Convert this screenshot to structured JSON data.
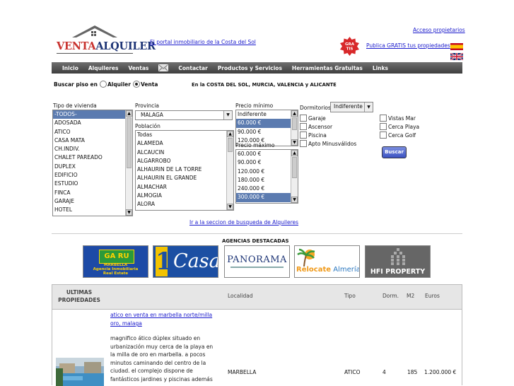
{
  "header": {
    "logo_text_1": "VENTA",
    "logo_text_2": "ALQUILER",
    "tagline": "El portal inmobiliario de la Costa del Sol",
    "access_link": "Acceso propietarios",
    "publish_link": "Publica GRATIS tus propiedades",
    "gratis_badge": "GRATIS"
  },
  "nav": {
    "items": [
      "Inicio",
      "Alquileres",
      "Ventas",
      "Contactar",
      "Productos y Servicios",
      "Herramientas Gratuitas",
      "Links"
    ]
  },
  "search": {
    "label": "Buscar piso en",
    "option_rent": "Alquiler",
    "option_sale": "Venta",
    "selected": "Venta",
    "region_text": "En la COSTA DEL SOL, MURCIA, VALENCIA y ALICANTE",
    "tipo_label": "Tipo de vivienda",
    "tipo_options": [
      "-TODOS-",
      "ADOSADA",
      "ATICO",
      "CASA MATA",
      "CH.INDIV.",
      "CHALET PAREADO",
      "DUPLEX",
      "EDIFICIO",
      "ESTUDIO",
      "FINCA",
      "GARAJE",
      "HOTEL"
    ],
    "provincia_label": "Provincia",
    "provincia_value": "MALAGA",
    "poblacion_label": "Población",
    "poblacion_options": [
      "Todas",
      "ALAMEDA",
      "ALCAUCIN",
      "ALGARROBO",
      "ALHAURIN DE LA TORRE",
      "ALHAURIN EL GRANDE",
      "ALMACHAR",
      "ALMOGIA",
      "ALORA"
    ],
    "precio_min_label": "Precio mínimo",
    "precio_min_options": [
      "Indiferente",
      "60.000 €",
      "90.000 €",
      "120.000 €"
    ],
    "precio_max_label": "Precio máximo",
    "precio_max_options": [
      "60.000 €",
      "90.000 €",
      "120.000 €",
      "180.000 €",
      "240.000 €",
      "300.000 €"
    ],
    "dormitorios_label": "Dormitorios",
    "dormitorios_value": "Indiferente",
    "checks_left": [
      "Garaje",
      "Ascensor",
      "Piscina",
      "Apto Minusválidos"
    ],
    "checks_right": [
      "Vistas Mar",
      "Cerca Playa",
      "Cerca Golf"
    ],
    "button": "Buscar",
    "alquileres_link": "Ir a la seccion de busqueda de Alquileres"
  },
  "agencies": {
    "title": "AGENCIAS DESTACADAS",
    "garu": {
      "top": "GA RU",
      "sub1": "MARBELLA",
      "sub2": "Agencia Inmobiliaria",
      "sub3": "Real Estate"
    },
    "unocasa": {
      "num": "1",
      "word": "Casa"
    },
    "panorama": {
      "name": "PANORAMA"
    },
    "relocate": {
      "word1": "Relocate",
      "word2": "Almería"
    },
    "hfi": {
      "name": "HFI PROPERTY"
    }
  },
  "table": {
    "headers": {
      "title_1": "ULTIMAS",
      "title_2": "PROPIEDADES",
      "localidad": "Localidad",
      "tipo": "Tipo",
      "dorm": "Dorm.",
      "m2": "M2",
      "euros": "Euros"
    },
    "rows": [
      {
        "link_1": "atico en venta en marbella norte/milla",
        "link_2": "oro, malaga",
        "desc": [
          "magnifico ático dúplex situado en",
          "urbanización muy cerca de la playa en",
          "la milla de oro en marbella. a pocos",
          "minutos caminando del centro de la",
          "ciudad. el complejo dispone de",
          "fantásticos jardines y piscinas además"
        ],
        "localidad": "MARBELLA",
        "tipo": "ATICO",
        "dorm": "4",
        "m2": "185",
        "euros": "1.200.000 €"
      }
    ]
  },
  "colors": {
    "brand_red": "#c8322e",
    "brand_blue": "#1e3576",
    "nav_bg": "#4e4e4e",
    "selection": "#5b7bb0"
  }
}
